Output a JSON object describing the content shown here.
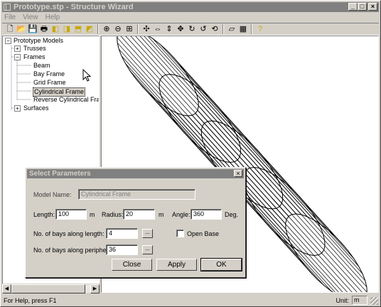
{
  "window": {
    "title": "Prototype.stp - Structure Wizard"
  },
  "menu": [
    "File",
    "View",
    "Help"
  ],
  "toolbar": {
    "icons": [
      "new-icon",
      "open-icon",
      "save-icon",
      "print-icon",
      "cube-front-icon",
      "cube-side-icon",
      "cube-top-icon",
      "cube-iso-icon",
      "zoom-in-icon",
      "zoom-out-icon",
      "zoom-fit-icon",
      "move-icon",
      "move-horizontal-icon",
      "move-vertical-icon",
      "rotate-4way-icon",
      "rotate-x-icon",
      "rotate-y-icon",
      "rotate-z-icon",
      "wireframe-icon",
      "hidden-line-icon",
      "help-icon"
    ]
  },
  "tree": {
    "root": "Prototype Models",
    "trusses": "Trusses",
    "frames": "Frames",
    "frame_items": [
      "Beam",
      "Bay Frame",
      "Grid Frame",
      "Cylindrical Frame",
      "Reverse Cylindrical Frame"
    ],
    "surfaces": "Surfaces",
    "selected": "Cylindrical Frame"
  },
  "dialog": {
    "title": "Select Parameters",
    "model_name_label": "Model Name:",
    "model_name_value": "Cylindrical Frame",
    "length_label": "Length:",
    "length_value": "100",
    "length_unit": "m",
    "radius_label": "Radius:",
    "radius_value": "20",
    "radius_unit": "m",
    "angle_label": "Angle:",
    "angle_value": "360",
    "angle_unit": "Deg.",
    "bays_length_label": "No. of bays along length:",
    "bays_length_value": "4",
    "bays_periphery_label": "No. of bays along peripher:",
    "bays_periphery_value": "36",
    "browse_label": "...",
    "open_base_label": "Open Base",
    "open_base_checked": false,
    "close_label": "Close",
    "apply_label": "Apply",
    "ok_label": "OK"
  },
  "status": {
    "text": "For Help, press F1",
    "unit_label": "Unit:",
    "unit_value": "m"
  },
  "colors": {
    "titlebar_inactive": "#808080",
    "face": "#d4d0c8",
    "canvas": "#ffffff",
    "wire": "#000000"
  }
}
